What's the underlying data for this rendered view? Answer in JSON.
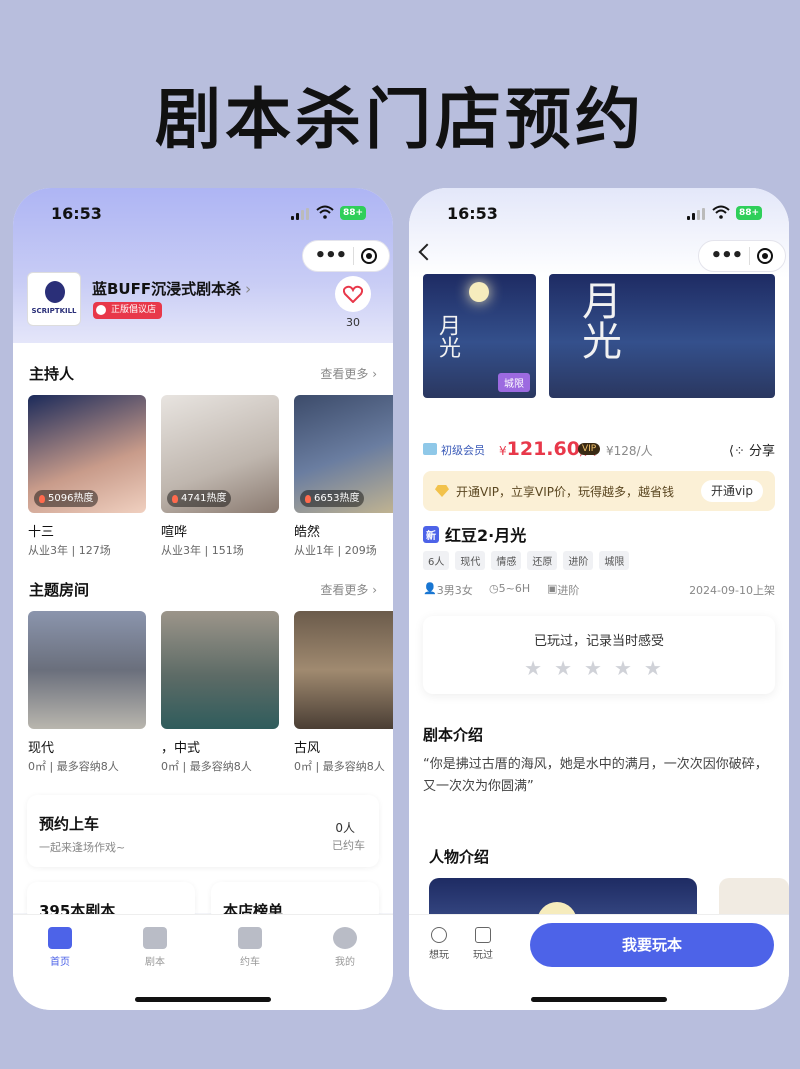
{
  "headline": "剧本杀门店预约",
  "status": {
    "time": "16:53",
    "battery": "88+"
  },
  "home": {
    "shop_name": "蓝BUFF沉浸式剧本杀",
    "shop_logo_text": "SCRIPTKILL",
    "shop_badge": "正版倡议店",
    "fav_count": "30",
    "hosts_title": "主持人",
    "hosts_more": "查看更多 ›",
    "hosts": [
      {
        "name": "十三",
        "sub": "从业3年 | 127场",
        "heat": "5096热度"
      },
      {
        "name": "喧哗",
        "sub": "从业3年 | 151场",
        "heat": "4741热度"
      },
      {
        "name": "皓然",
        "sub": "从业1年 | 209场",
        "heat": "6653热度"
      }
    ],
    "rooms_title": "主题房间",
    "rooms_more": "查看更多 ›",
    "rooms": [
      {
        "name": "现代",
        "sub": "0㎡ | 最多容纳8人"
      },
      {
        "name": "，中式",
        "sub": "0㎡ | 最多容纳8人"
      },
      {
        "name": "古风",
        "sub": "0㎡ | 最多容纳8人"
      }
    ],
    "booking_title": "预约上车",
    "booking_sub": "一起来逢场作戏~",
    "booking_count": "0人",
    "booking_count_label": "已约车",
    "scripts_count": "395本剧本",
    "ranking": "本店榜单",
    "tabs": [
      {
        "label": "首页",
        "icon": "home-icon"
      },
      {
        "label": "剧本",
        "icon": "book-icon"
      },
      {
        "label": "约车",
        "icon": "car-icon"
      },
      {
        "label": "我的",
        "icon": "user-icon"
      }
    ]
  },
  "detail": {
    "poster_text": "月光",
    "poster_tag": "城限",
    "member_level": "初级会员",
    "price_prefix": "¥",
    "price_value": "121.60",
    "price_unit": "/人",
    "vip_badge": "VIP",
    "orig_price": "¥128/人",
    "share": "分享",
    "vip_promo": "开通VIP，立享VIP价，玩得越多，越省钱",
    "vip_button": "开通vip",
    "new_badge": "新",
    "title": "红豆2·月光",
    "tags": [
      "6人",
      "现代",
      "情感",
      "还原",
      "进阶",
      "城限"
    ],
    "players": "3男3女",
    "duration": "5~6H",
    "difficulty": "进阶",
    "release": "2024-09-10上架",
    "played_prompt": "已玩过，记录当时感受",
    "stars": "★★★★★",
    "intro_title": "剧本介绍",
    "intro_text": "“你是拂过古厝的海风，她是水中的满月，一次次因你破碎，又一次次为你圆满”",
    "roles_title": "人物介绍",
    "want": "想玩",
    "played": "玩过",
    "cta": "我要玩本"
  },
  "colors": {
    "accent": "#4d63e8",
    "price": "#e8384a",
    "badge": "#e8384a"
  }
}
